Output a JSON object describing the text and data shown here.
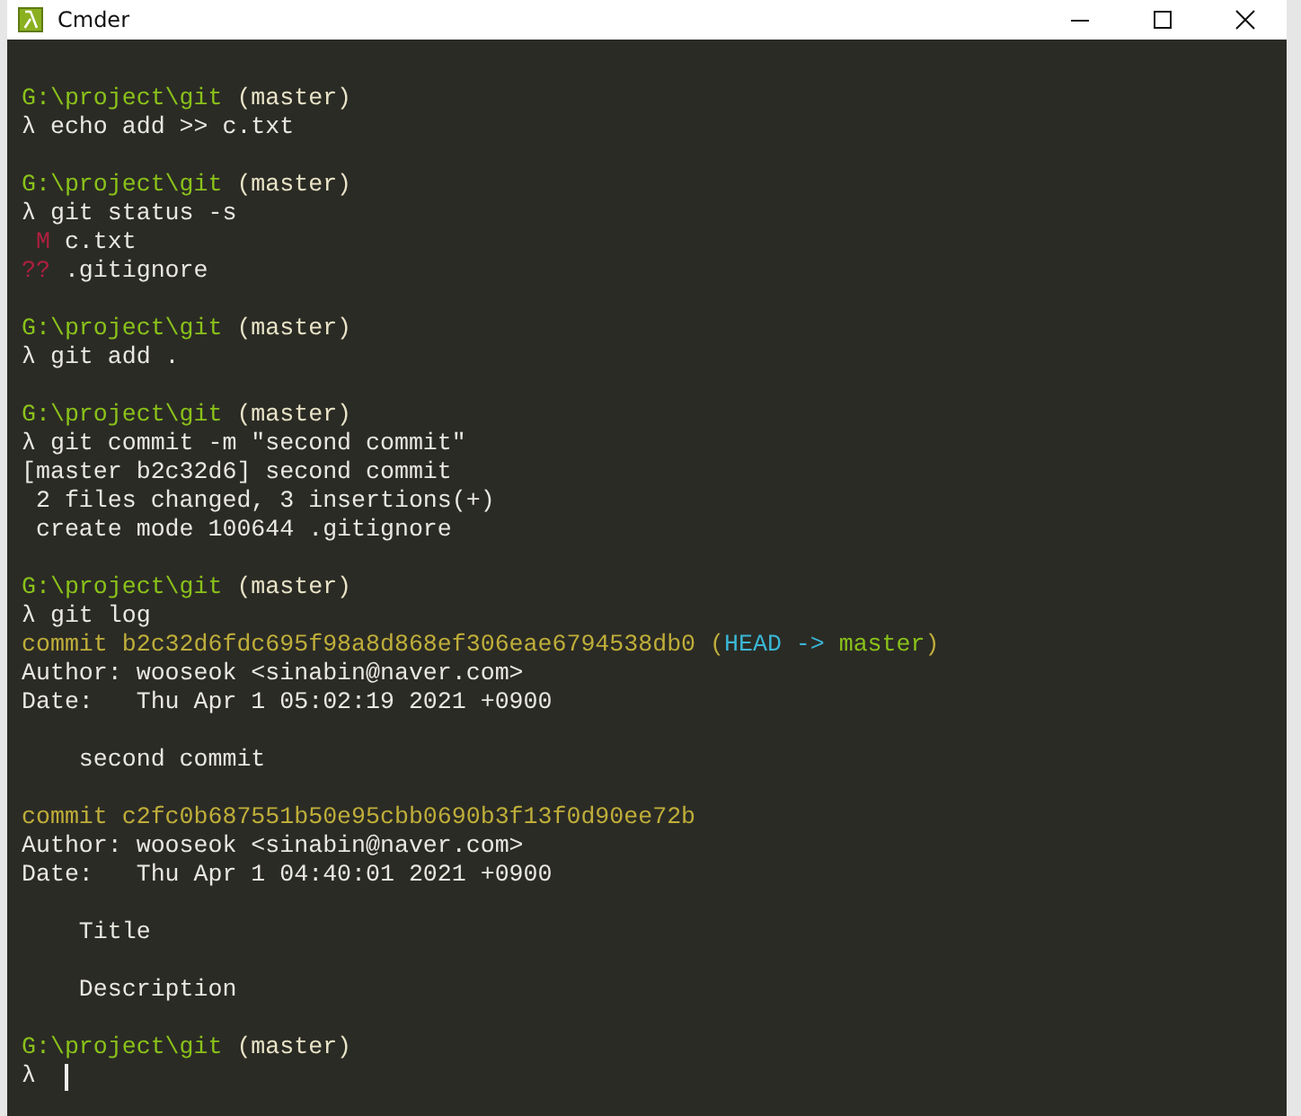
{
  "window": {
    "title": "Cmder"
  },
  "lines": [
    {
      "space_before": true,
      "cursor": false,
      "spans": [
        {
          "kind": "path",
          "text": "G:\\project\\git"
        },
        {
          "kind": "branch",
          "text": " (master)"
        }
      ]
    },
    {
      "space_before": false,
      "cursor": false,
      "spans": [
        {
          "kind": "text",
          "text": "λ echo add >> c.txt"
        }
      ]
    },
    {
      "space_before": true,
      "cursor": false,
      "spans": [
        {
          "kind": "path",
          "text": "G:\\project\\git"
        },
        {
          "kind": "branch",
          "text": " (master)"
        }
      ]
    },
    {
      "space_before": false,
      "cursor": false,
      "spans": [
        {
          "kind": "text",
          "text": "λ git status -s"
        }
      ]
    },
    {
      "space_before": false,
      "cursor": false,
      "spans": [
        {
          "kind": "status",
          "text": " M"
        },
        {
          "kind": "text",
          "text": " c.txt"
        }
      ]
    },
    {
      "space_before": false,
      "cursor": false,
      "spans": [
        {
          "kind": "status",
          "text": "??"
        },
        {
          "kind": "text",
          "text": " .gitignore"
        }
      ]
    },
    {
      "space_before": true,
      "cursor": false,
      "spans": [
        {
          "kind": "path",
          "text": "G:\\project\\git"
        },
        {
          "kind": "branch",
          "text": " (master)"
        }
      ]
    },
    {
      "space_before": false,
      "cursor": false,
      "spans": [
        {
          "kind": "text",
          "text": "λ git add ."
        }
      ]
    },
    {
      "space_before": true,
      "cursor": false,
      "spans": [
        {
          "kind": "path",
          "text": "G:\\project\\git"
        },
        {
          "kind": "branch",
          "text": " (master)"
        }
      ]
    },
    {
      "space_before": false,
      "cursor": false,
      "spans": [
        {
          "kind": "text",
          "text": "λ git commit -m \"second commit\""
        }
      ]
    },
    {
      "space_before": false,
      "cursor": false,
      "spans": [
        {
          "kind": "text",
          "text": "[master b2c32d6] second commit"
        }
      ]
    },
    {
      "space_before": false,
      "cursor": false,
      "spans": [
        {
          "kind": "text",
          "text": " 2 files changed, 3 insertions(+)"
        }
      ]
    },
    {
      "space_before": false,
      "cursor": false,
      "spans": [
        {
          "kind": "text",
          "text": " create mode 100644 .gitignore"
        }
      ]
    },
    {
      "space_before": true,
      "cursor": false,
      "spans": [
        {
          "kind": "path",
          "text": "G:\\project\\git"
        },
        {
          "kind": "branch",
          "text": " (master)"
        }
      ]
    },
    {
      "space_before": false,
      "cursor": false,
      "spans": [
        {
          "kind": "text",
          "text": "λ git log"
        }
      ]
    },
    {
      "space_before": false,
      "cursor": false,
      "spans": [
        {
          "kind": "hash",
          "text": "commit b2c32d6fdc695f98a8d868ef306eae6794538db0 ("
        },
        {
          "kind": "head",
          "text": "HEAD -> "
        },
        {
          "kind": "path",
          "text": "master"
        },
        {
          "kind": "hash",
          "text": ")"
        }
      ]
    },
    {
      "space_before": false,
      "cursor": false,
      "spans": [
        {
          "kind": "text",
          "text": "Author: wooseok <sinabin@naver.com>"
        }
      ]
    },
    {
      "space_before": false,
      "cursor": false,
      "spans": [
        {
          "kind": "text",
          "text": "Date:   Thu Apr 1 05:02:19 2021 +0900"
        }
      ]
    },
    {
      "space_before": true,
      "cursor": false,
      "spans": [
        {
          "kind": "text",
          "text": "    second commit"
        }
      ]
    },
    {
      "space_before": true,
      "cursor": false,
      "spans": [
        {
          "kind": "hash",
          "text": "commit c2fc0b687551b50e95cbb0690b3f13f0d90ee72b"
        }
      ]
    },
    {
      "space_before": false,
      "cursor": false,
      "spans": [
        {
          "kind": "text",
          "text": "Author: wooseok <sinabin@naver.com>"
        }
      ]
    },
    {
      "space_before": false,
      "cursor": false,
      "spans": [
        {
          "kind": "text",
          "text": "Date:   Thu Apr 1 04:40:01 2021 +0900"
        }
      ]
    },
    {
      "space_before": true,
      "cursor": false,
      "spans": [
        {
          "kind": "text",
          "text": "    Title"
        }
      ]
    },
    {
      "space_before": true,
      "cursor": false,
      "spans": [
        {
          "kind": "text",
          "text": "    Description"
        }
      ]
    },
    {
      "space_before": true,
      "cursor": false,
      "spans": [
        {
          "kind": "path",
          "text": "G:\\project\\git"
        },
        {
          "kind": "branch",
          "text": " (master)"
        }
      ]
    },
    {
      "space_before": false,
      "cursor": true,
      "spans": [
        {
          "kind": "text",
          "text": "λ "
        }
      ]
    }
  ]
}
